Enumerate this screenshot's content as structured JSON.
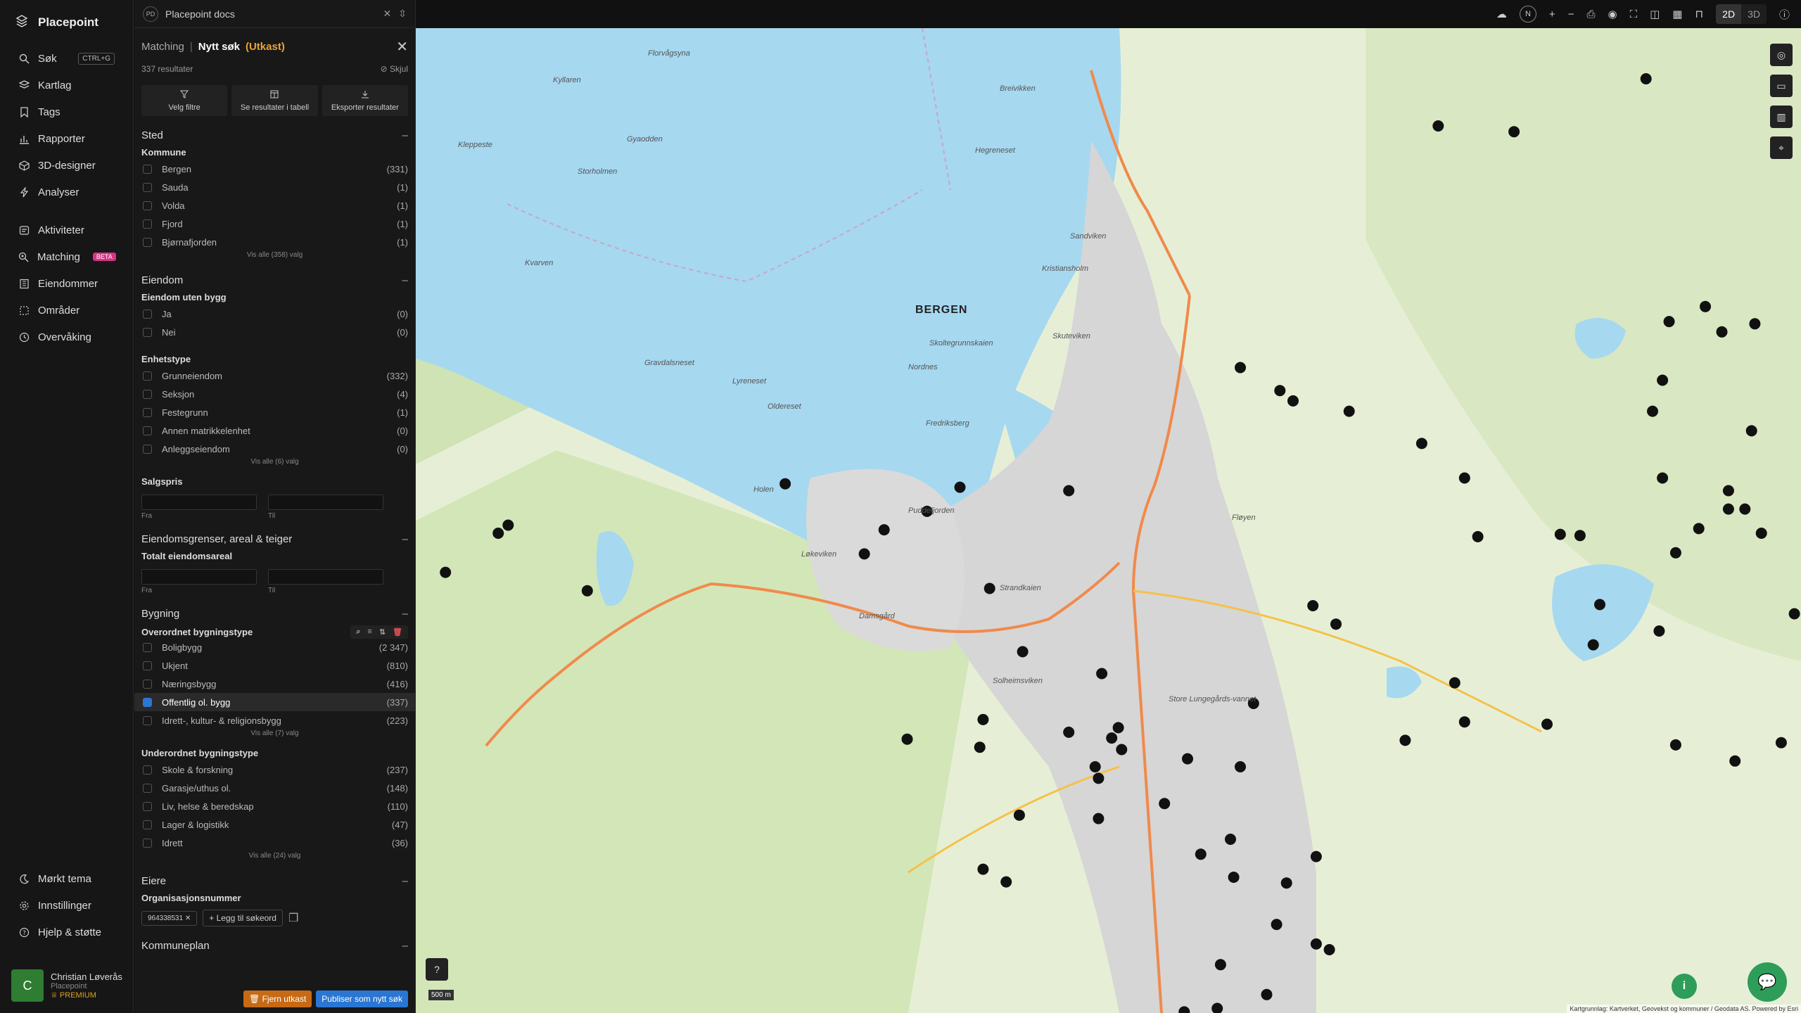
{
  "app": {
    "brand": "Placepoint",
    "docs_title": "Placepoint docs",
    "docs_badge": "PD"
  },
  "nav": {
    "items": [
      {
        "label": "Søk",
        "kbd": "CTRL+G"
      },
      {
        "label": "Kartlag"
      },
      {
        "label": "Tags"
      },
      {
        "label": "Rapporter"
      },
      {
        "label": "3D-designer"
      },
      {
        "label": "Analyser"
      },
      {
        "label": "Aktiviteter"
      },
      {
        "label": "Matching",
        "badge": "BETA"
      },
      {
        "label": "Eiendommer"
      },
      {
        "label": "Områder"
      },
      {
        "label": "Overvåking"
      }
    ],
    "bottom": [
      {
        "label": "Mørkt tema"
      },
      {
        "label": "Innstillinger"
      },
      {
        "label": "Hjelp & støtte"
      }
    ],
    "user": {
      "initial": "C",
      "name": "Christian Løverås",
      "org": "Placepoint",
      "plan": "PREMIUM"
    }
  },
  "panel": {
    "crumb": "Matching",
    "title": "Nytt søk",
    "status": "(Utkast)",
    "results": "337 resultater",
    "hide": "Skjul",
    "actions": [
      "Velg filtre",
      "Se resultater i tabell",
      "Eksporter resultater"
    ],
    "sted": {
      "title": "Sted",
      "kommune_label": "Kommune",
      "kommune": [
        {
          "name": "Bergen",
          "count": "(331)"
        },
        {
          "name": "Sauda",
          "count": "(1)"
        },
        {
          "name": "Volda",
          "count": "(1)"
        },
        {
          "name": "Fjord",
          "count": "(1)"
        },
        {
          "name": "Bjørnafjorden",
          "count": "(1)"
        }
      ],
      "show_all": "Vis alle (358) valg"
    },
    "eiendom": {
      "title": "Eiendom",
      "uten_bygg_label": "Eiendom uten bygg",
      "uten_bygg": [
        {
          "name": "Ja",
          "count": "(0)"
        },
        {
          "name": "Nei",
          "count": "(0)"
        }
      ],
      "enhetstype_label": "Enhetstype",
      "enhetstype": [
        {
          "name": "Grunneiendom",
          "count": "(332)"
        },
        {
          "name": "Seksjon",
          "count": "(4)"
        },
        {
          "name": "Festegrunn",
          "count": "(1)"
        },
        {
          "name": "Annen matrikkelenhet",
          "count": "(0)"
        },
        {
          "name": "Anleggseiendom",
          "count": "(0)"
        }
      ],
      "show_all": "Vis alle (6) valg",
      "salgspris_label": "Salgspris",
      "from": "Fra",
      "to": "Til"
    },
    "grenser": {
      "title": "Eiendomsgrenser, areal & teiger",
      "areal_label": "Totalt eiendomsareal",
      "from": "Fra",
      "to": "Til"
    },
    "bygning": {
      "title": "Bygning",
      "overordnet_label": "Overordnet bygningstype",
      "overordnet": [
        {
          "name": "Boligbygg",
          "count": "(2 347)"
        },
        {
          "name": "Ukjent",
          "count": "(810)"
        },
        {
          "name": "Næringsbygg",
          "count": "(416)"
        },
        {
          "name": "Offentlig ol. bygg",
          "count": "(337)",
          "selected": true
        },
        {
          "name": "Idrett-, kultur- & religionsbygg",
          "count": "(223)"
        }
      ],
      "show_all_1": "Vis alle (7) valg",
      "underordnet_label": "Underordnet bygningstype",
      "underordnet": [
        {
          "name": "Skole & forskning",
          "count": "(237)"
        },
        {
          "name": "Garasje/uthus ol.",
          "count": "(148)"
        },
        {
          "name": "Liv, helse & beredskap",
          "count": "(110)"
        },
        {
          "name": "Lager & logistikk",
          "count": "(47)"
        },
        {
          "name": "Idrett",
          "count": "(36)"
        }
      ],
      "show_all_2": "Vis alle (24) valg"
    },
    "eiere": {
      "title": "Eiere",
      "org_label": "Organisasjonsnummer",
      "chip": "964338531",
      "add": "Legg til søkeord"
    },
    "kommuneplan": {
      "title": "Kommuneplan"
    },
    "buttons": {
      "remove": "Fjern utkast",
      "publish": "Publiser som nytt søk"
    }
  },
  "toolbar": {
    "compass": "N",
    "view_2d": "2D",
    "view_3d": "3D",
    "active_view": "2D"
  },
  "map": {
    "city": "BERGEN",
    "scale": "500 m",
    "attribution": "Kartgrunnlag: Kartverket, Geovekst og kommuner / Geodata AS. Powered by Esri",
    "labels": [
      "Florvågsyna",
      "Kyllaren",
      "Gyaodden",
      "Kleppeste",
      "Storholmen",
      "Breivikken",
      "Hegreneset",
      "Sandviken",
      "Kristiansholm",
      "Skuteviken",
      "Skoltegrunnskaien",
      "Nordnes",
      "Fredriksberg",
      "Gravdalsneset",
      "Lyreneset",
      "Oldereset",
      "Holen",
      "Løkeviken",
      "Store Lungegårds-vannet",
      "Fløyen",
      "Kvarven",
      "Damsgård",
      "Solheimsviken",
      "Puddefjorden",
      "Strandkaien"
    ],
    "point_color": "#111111",
    "water_color": "#a6d8f0",
    "land_color": "#e6efd6",
    "road_color": "#f08a4b"
  }
}
